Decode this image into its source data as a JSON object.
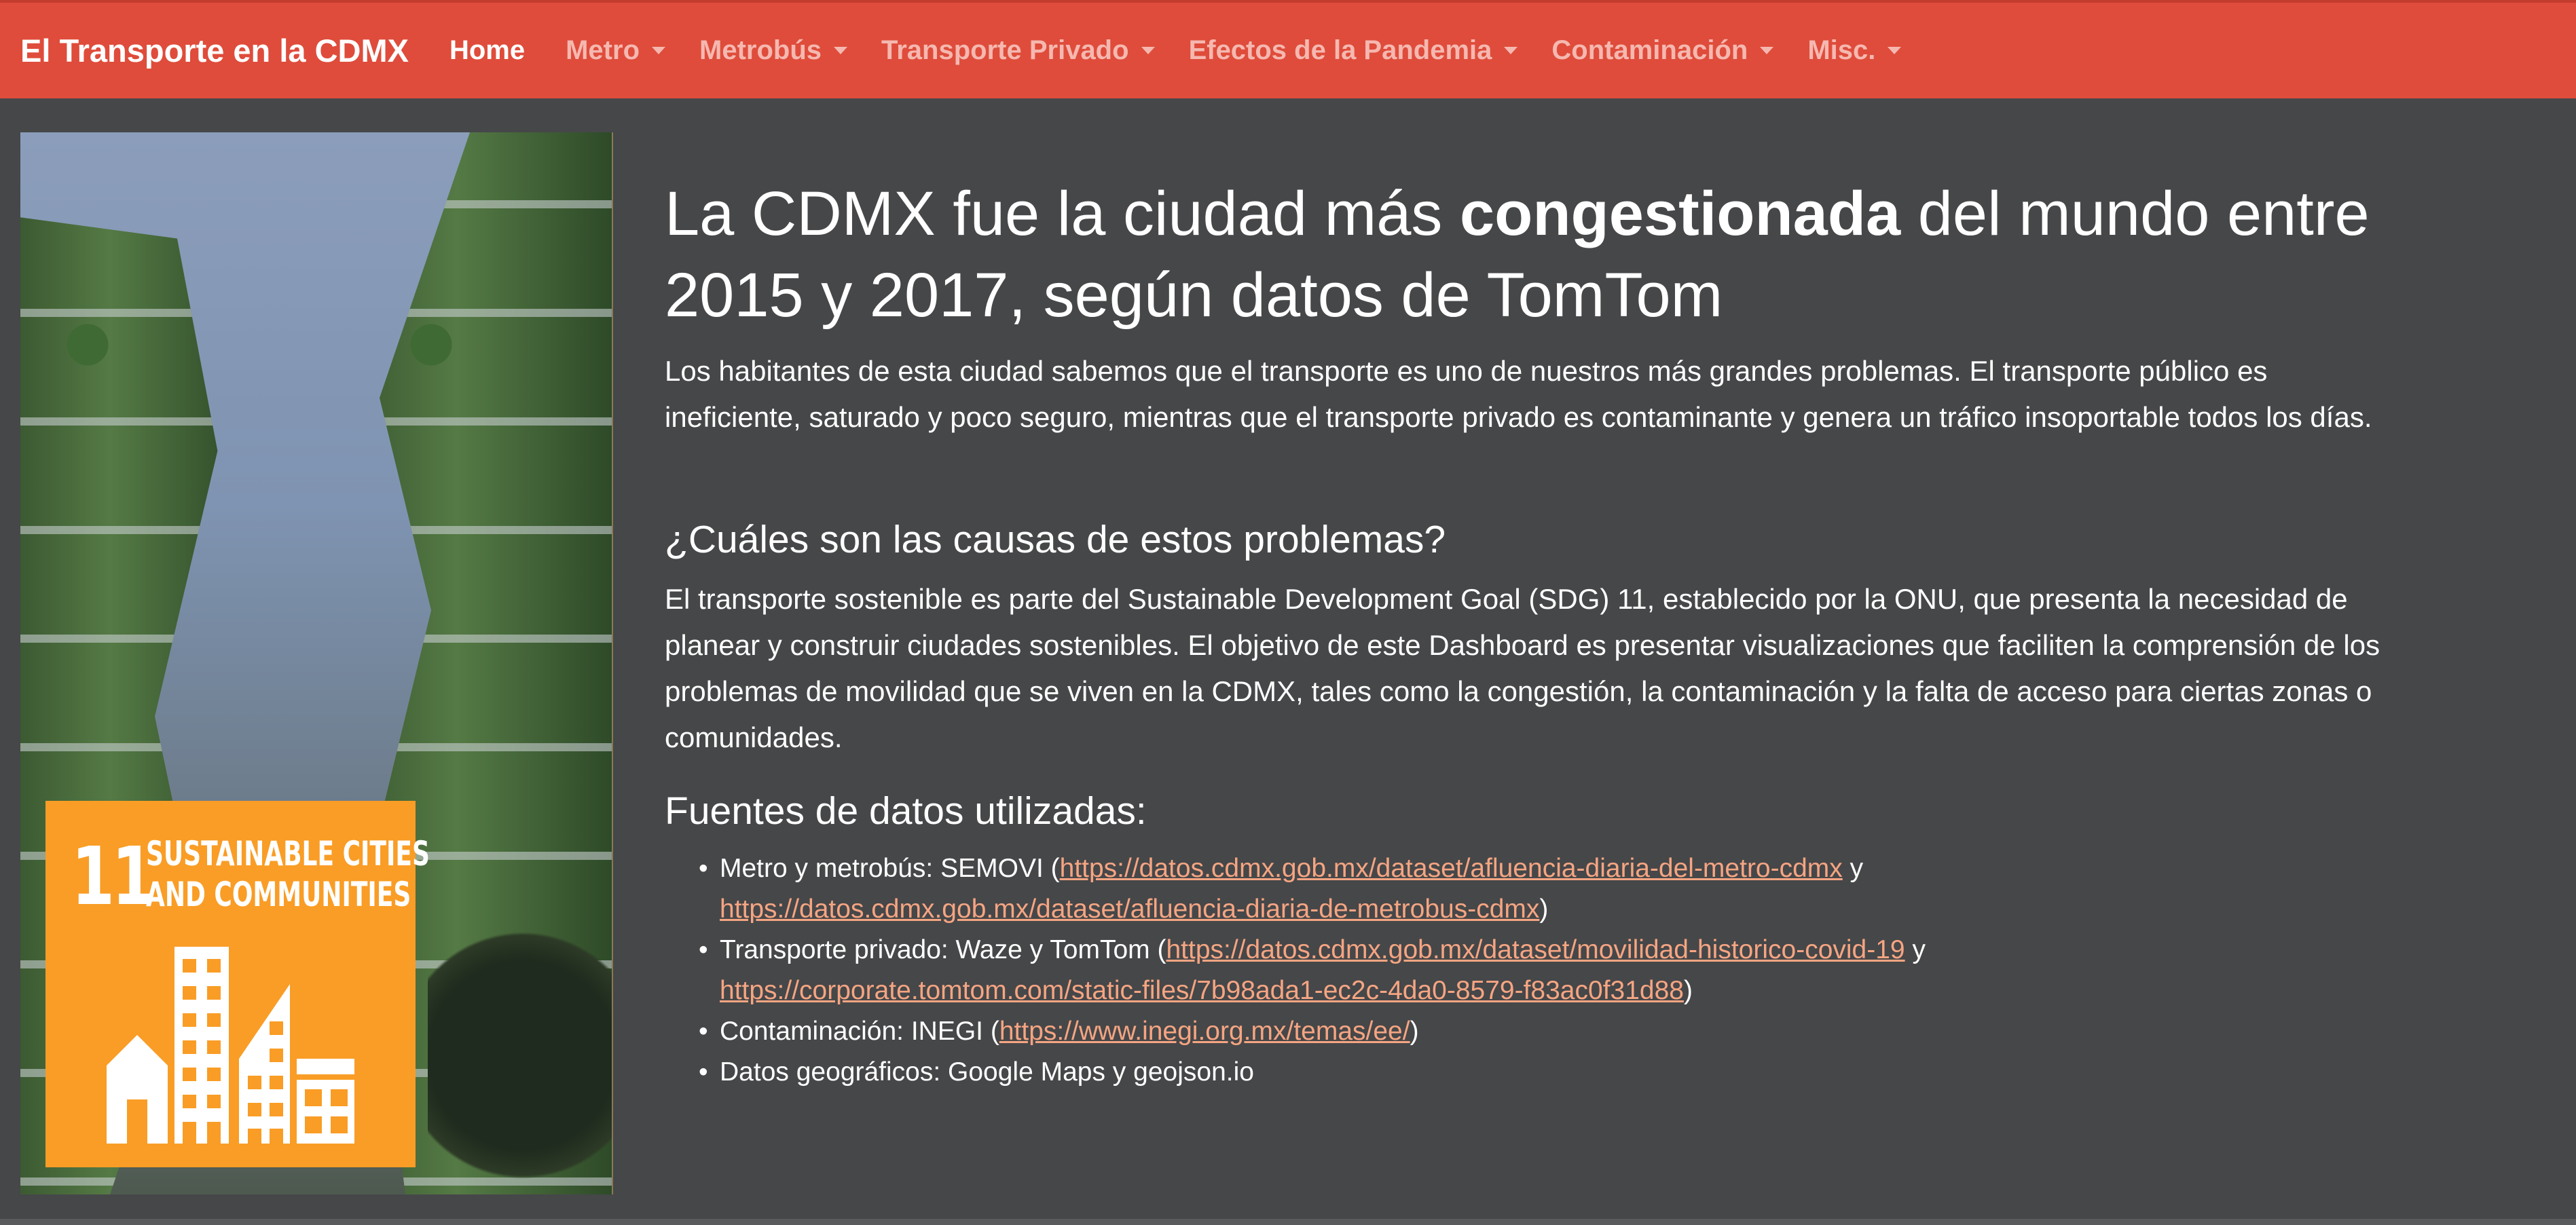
{
  "navbar": {
    "brand": "El Transporte en la CDMX",
    "items": [
      {
        "label": "Home",
        "active": true
      },
      {
        "label": "Metro",
        "dropdown": true
      },
      {
        "label": "Metrobús",
        "dropdown": true
      },
      {
        "label": "Transporte Privado",
        "dropdown": true
      },
      {
        "label": "Efectos de la Pandemia",
        "dropdown": true
      },
      {
        "label": "Contaminación",
        "dropdown": true
      },
      {
        "label": "Misc.",
        "dropdown": true
      }
    ]
  },
  "hero_badge": {
    "number": "11",
    "title_line1": "SUSTAINABLE CITIES",
    "title_line2": "AND COMMUNITIES",
    "color": "#f99d26"
  },
  "heading": {
    "before": "La CDMX fue la ciudad más ",
    "bold": "congestionada",
    "after": " del mundo entre 2015 y 2017, según datos de TomTom"
  },
  "intro": "Los habitantes de esta ciudad sabemos que el transporte es uno de nuestros más grandes problemas. El transporte público es ineficiente, saturado y poco seguro, mientras que el transporte privado es contaminante y genera un tráfico insoportable todos los días.",
  "causes": {
    "title": "¿Cuáles son las causas de estos problemas?",
    "text": "El transporte sostenible es parte del Sustainable Development Goal (SDG) 11, establecido por la ONU, que presenta la necesidad de planear y construir ciudades sostenibles. El objetivo de este Dashboard es presentar visualizaciones que faciliten la comprensión de los problemas de movilidad que se viven en la CDMX, tales como la congestión, la contaminación y la falta de acceso para ciertas zonas o comunidades."
  },
  "sources": {
    "title": "Fuentes de datos utilizadas:",
    "metro": {
      "label": "Metro y metrobús: SEMOVI (",
      "link1": "https://datos.cdmx.gob.mx/dataset/afluencia-diaria-del-metro-cdmx",
      "joiner": " y ",
      "link2": "https://datos.cdmx.gob.mx/dataset/afluencia-diaria-de-metrobus-cdmx",
      "close": ")"
    },
    "private": {
      "label": "Transporte privado: Waze y TomTom (",
      "link1": "https://datos.cdmx.gob.mx/dataset/movilidad-historico-covid-19",
      "joiner": " y ",
      "link2": "https://corporate.tomtom.com/static-files/7b98ada1-ec2c-4da0-8579-f83ac0f31d88",
      "close": ")"
    },
    "pollution": {
      "label": "Contaminación: INEGI (",
      "link1": "https://www.inegi.org.mx/temas/ee/",
      "close": ")"
    },
    "geo": "Datos geográficos: Google Maps y geojson.io"
  }
}
